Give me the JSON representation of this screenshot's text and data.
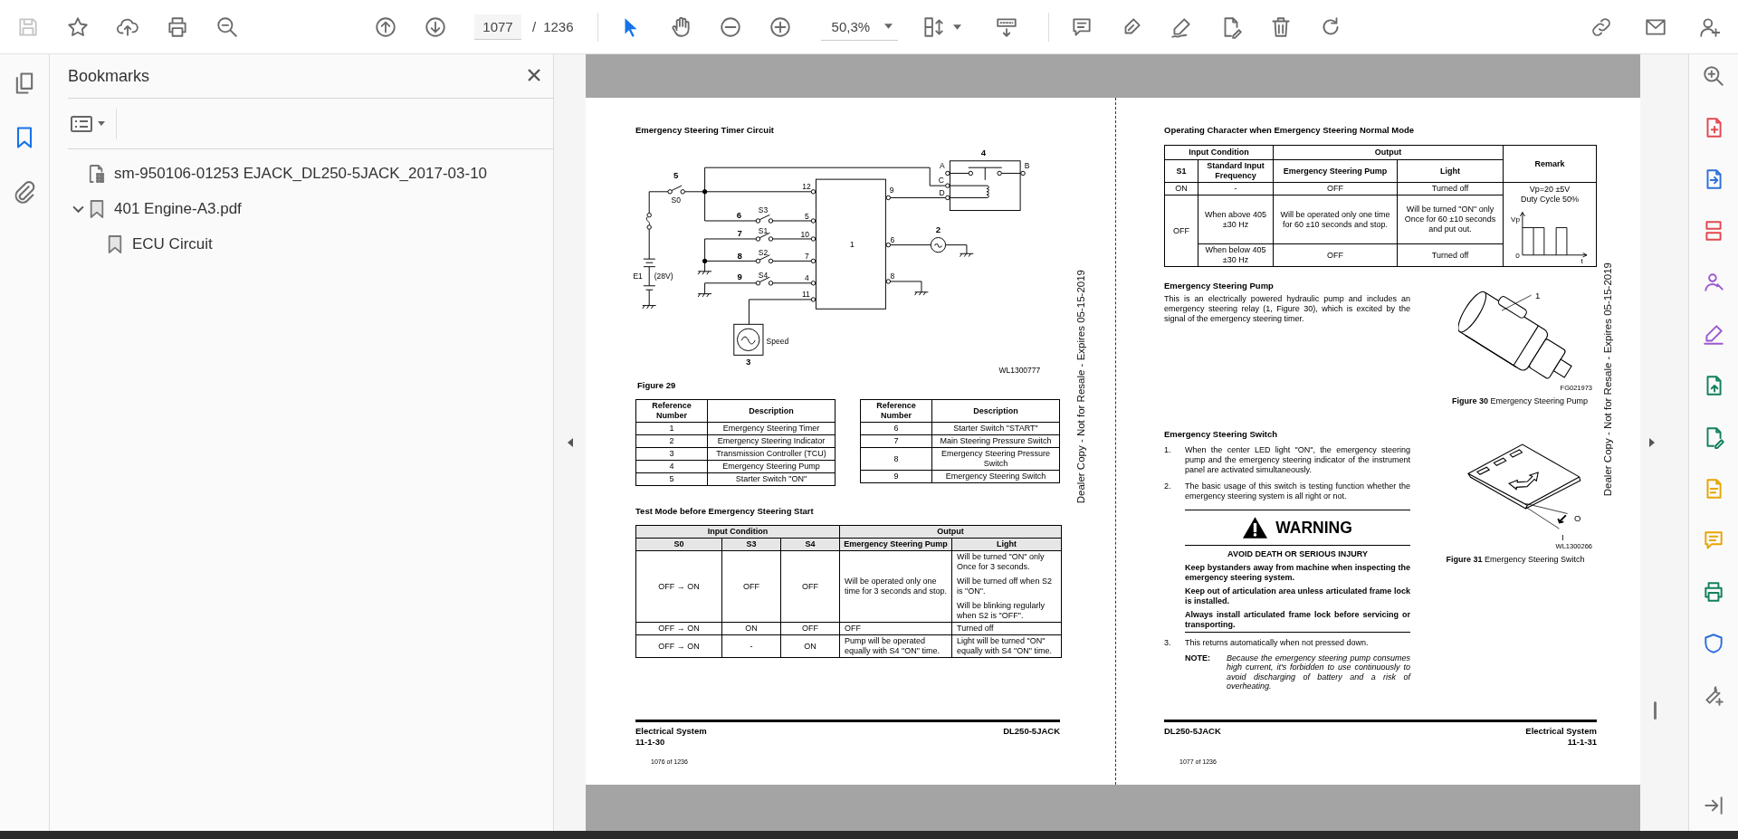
{
  "toolbar": {
    "page_number": "1077",
    "page_separator": "/",
    "page_count": "1236",
    "zoom_level": "50,3%"
  },
  "nav_rail": [
    {
      "kind": "pages",
      "selected": false
    },
    {
      "kind": "bookmarks",
      "selected": true
    },
    {
      "kind": "attachments",
      "selected": false
    }
  ],
  "bookmarks_panel": {
    "title": "Bookmarks",
    "items": [
      {
        "kind": "document",
        "label": "sm-950106-01253 EJACK_DL250-5JACK_2017-03-10"
      },
      {
        "kind": "bookmark",
        "label": "401 Engine-A3.pdf",
        "expanded": true,
        "children": [
          {
            "kind": "bookmark",
            "label": "ECU Circuit"
          }
        ]
      }
    ]
  },
  "left_page": {
    "heading": "Emergency Steering Timer Circuit",
    "circuit_labels": [
      {
        "kind": "component",
        "text": "5"
      },
      {
        "kind": "pin",
        "text": "S0"
      },
      {
        "kind": "label",
        "text": "E1"
      },
      {
        "kind": "label",
        "text": "(28V)"
      },
      {
        "kind": "component",
        "text": "6"
      },
      {
        "kind": "pin",
        "text": "S3"
      },
      {
        "kind": "component",
        "text": "7"
      },
      {
        "kind": "pin",
        "text": "S1"
      },
      {
        "kind": "component",
        "text": "8"
      },
      {
        "kind": "pin",
        "text": "S2"
      },
      {
        "kind": "component",
        "text": "9"
      },
      {
        "kind": "pin",
        "text": "S4"
      },
      {
        "kind": "pin",
        "text": "12"
      },
      {
        "kind": "pin",
        "text": "5"
      },
      {
        "kind": "pin",
        "text": "10"
      },
      {
        "kind": "pin",
        "text": "7"
      },
      {
        "kind": "pin",
        "text": "4"
      },
      {
        "kind": "pin",
        "text": "11"
      },
      {
        "kind": "pin",
        "text": "1"
      },
      {
        "kind": "pin",
        "text": "9"
      },
      {
        "kind": "pin",
        "text": "6"
      },
      {
        "kind": "pin",
        "text": "8"
      },
      {
        "kind": "component",
        "text": "4"
      },
      {
        "kind": "pin",
        "text": "A"
      },
      {
        "kind": "pin",
        "text": "B"
      },
      {
        "kind": "pin",
        "text": "C"
      },
      {
        "kind": "pin",
        "text": "D"
      },
      {
        "kind": "component",
        "text": "2"
      },
      {
        "kind": "component",
        "text": "3"
      },
      {
        "kind": "label",
        "text": "Speed"
      },
      {
        "kind": "code",
        "text": "WL1300777"
      }
    ],
    "figure_label": "Figure 29",
    "reference_tables": [
      {
        "columns": [
          "Reference Number",
          "Description"
        ],
        "rows": [
          [
            "1",
            "Emergency Steering Timer"
          ],
          [
            "2",
            "Emergency Steering Indicator"
          ],
          [
            "3",
            "Transmission Controller (TCU)"
          ],
          [
            "4",
            "Emergency Steering Pump"
          ],
          [
            "5",
            "Starter Switch \"ON\""
          ]
        ]
      },
      {
        "columns": [
          "Reference Number",
          "Description"
        ],
        "rows": [
          [
            "6",
            "Starter Switch \"START\""
          ],
          [
            "7",
            "Main Steering Pressure Switch"
          ],
          [
            "8",
            "Emergency Steering Pressure Switch"
          ],
          [
            "9",
            "Emergency Steering Switch"
          ]
        ]
      }
    ],
    "test_mode": {
      "heading": "Test Mode before Emergency Steering Start",
      "group_headers": [
        "Input Condition",
        "Output"
      ],
      "columns": [
        "S0",
        "S3",
        "S4",
        "Emergency Steering Pump",
        "Light"
      ],
      "rows": [
        {
          "cells": [
            [
              "OFF → ON"
            ],
            [
              "OFF"
            ],
            [
              "OFF"
            ],
            [
              "Will be operated only one time for 3 seconds and stop."
            ],
            [
              "Will be turned \"ON\" only Once for 3 seconds.",
              "Will be turned off when S2 is \"ON\".",
              "Will be blinking regularly when S2 is \"OFF\"."
            ]
          ]
        },
        {
          "cells": [
            [
              "OFF → ON"
            ],
            [
              "ON"
            ],
            [
              "OFF"
            ],
            [
              "OFF"
            ],
            [
              "Turned off"
            ]
          ]
        },
        {
          "cells": [
            [
              "OFF → ON"
            ],
            [
              "-"
            ],
            [
              "ON"
            ],
            [
              "Pump will be operated equally with S4 \"ON\" time."
            ],
            [
              "Light will be turned \"ON\" equally with S4 \"ON\" time."
            ]
          ]
        }
      ]
    },
    "side_note": "Dealer Copy - Not for Resale - Expires 05-15-2019",
    "footer": {
      "section": "Electrical System",
      "page_code": "11-1-30",
      "model": "DL250-5JACK",
      "page_count": "1076 of 1236"
    }
  },
  "right_page": {
    "operating_table": {
      "heading": "Operating Character when Emergency Steering Normal Mode",
      "group_headers": [
        "Input Condition",
        "Output",
        "Remark"
      ],
      "columns": [
        "S1",
        "Standard Input Frequency",
        "Emergency Steering Pump",
        "Light"
      ],
      "groups": [
        {
          "s1": "ON",
          "conditions": [
            {
              "frequency": "-",
              "pump": "OFF",
              "light": "Turned off"
            }
          ]
        },
        {
          "s1": "OFF",
          "conditions": [
            {
              "frequency": "When above 405 ±30 Hz",
              "pump": "Will be operated only one time for 60 ±10 seconds and stop.",
              "light": "Will be turned \"ON\" only Once for 60 ±10 seconds and put out."
            },
            {
              "frequency": "When below 405 ±30 Hz",
              "pump": "OFF",
              "light": "Turned off"
            }
          ]
        }
      ],
      "remark": {
        "lines": [
          "Vp=20 ±5V",
          "Duty Cycle 50%"
        ],
        "waveform_labels": [
          "Vp",
          "0",
          "t"
        ]
      }
    },
    "pump_section": {
      "heading": "Emergency Steering Pump",
      "paragraph": "This is an electrically powered hydraulic pump and includes an emergency steering relay (1, Figure 30), which is excited by the signal of the emergency steering timer.",
      "figure": {
        "callout": "1",
        "code": "FG021973",
        "caption": "**Figure 30** Emergency Steering Pump"
      }
    },
    "switch_section": {
      "heading": "Emergency Steering Switch",
      "steps": [
        {
          "number": "1.",
          "text": "When the center LED light \"ON\", the emergency steering pump and the emergency steering indicator of the instrument panel are activated simultaneously."
        },
        {
          "number": "2.",
          "text": "The basic usage of this switch is testing function whether the emergency steering system is all right or not."
        }
      ],
      "warning": {
        "title": "WARNING",
        "subtitle": "AVOID DEATH OR SERIOUS INJURY",
        "messages": [
          "Keep bystanders away from machine when inspecting the emergency steering system.",
          "Keep out of articulation area unless articulated frame lock is installed.",
          "Always install articulated frame lock before servicing or transporting."
        ]
      },
      "steps_after": [
        {
          "number": "3.",
          "text": "This returns automatically when not pressed down."
        }
      ],
      "note": {
        "label": "NOTE:",
        "text": "Because the emergency steering pump consumes high current, it's forbidden to use continuously to avoid discharging of battery and a risk of overheating."
      },
      "figure": {
        "labels": [
          "O",
          "I"
        ],
        "code": "WL1300266",
        "caption": "**Figure 31** Emergency Steering Switch"
      }
    },
    "side_note": "Dealer Copy - Not for Resale - Expires 05-15-2019",
    "footer": {
      "model": "DL250-5JACK",
      "section": "Electrical System",
      "page_code": "11-1-31",
      "page_count": "1077 of 1236"
    }
  }
}
